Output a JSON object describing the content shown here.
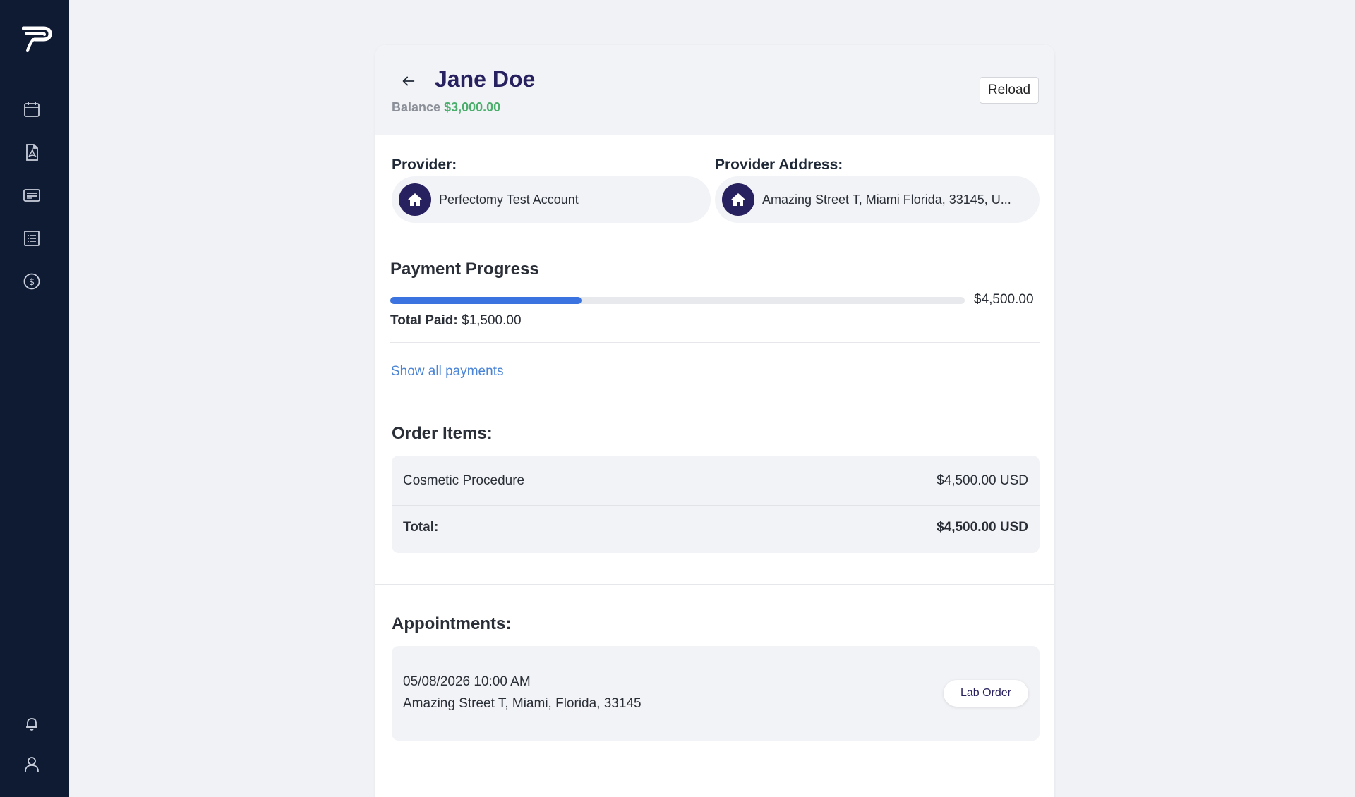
{
  "sidebar": {
    "logo": "perfectomy-logo",
    "icons": [
      "calendar-icon",
      "pdf-document-icon",
      "messages-icon",
      "list-icon",
      "dollar-icon",
      "bell-icon",
      "user-icon"
    ],
    "background": "#0f1a33"
  },
  "header": {
    "patient_name": "Jane Doe",
    "balance_label": "Balance",
    "balance_value": "$3,000.00",
    "reload_label": "Reload"
  },
  "provider": {
    "label": "Provider:",
    "name": "Perfectomy Test Account",
    "address_label": "Provider Address:",
    "address": "Amazing Street T, Miami Florida, 33145, U..."
  },
  "payment": {
    "title": "Payment Progress",
    "total_amount": "$4,500.00",
    "paid_label": "Total Paid:",
    "paid_value": "$1,500.00",
    "progress_fraction": 0.3333,
    "show_all_label": "Show all payments"
  },
  "order": {
    "title": "Order Items:",
    "items": [
      {
        "name": "Cosmetic Procedure",
        "price": "$4,500.00 USD"
      }
    ],
    "total_label": "Total:",
    "total_value": "$4,500.00 USD"
  },
  "appointments": {
    "title": "Appointments:",
    "items": [
      {
        "datetime": "05/08/2026 10:00 AM",
        "address": "Amazing Street T, Miami, Florida, 33145",
        "action_label": "Lab Order"
      }
    ]
  },
  "colors": {
    "brand": "#28215f",
    "balance": "#4caf6e",
    "progress": "#3b73e0",
    "link": "#4a84d6"
  }
}
